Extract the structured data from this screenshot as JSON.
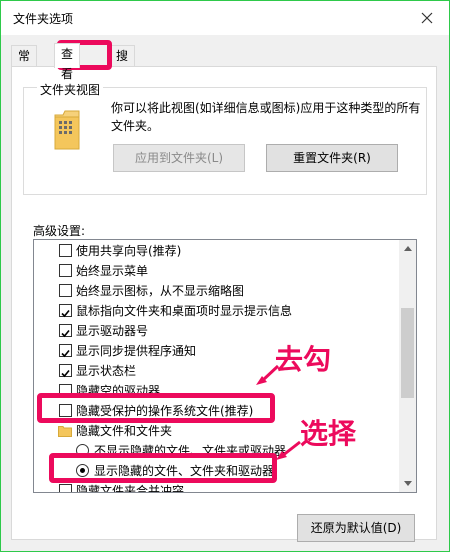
{
  "window": {
    "title": "文件夹选项"
  },
  "tabs": [
    {
      "label": "常规"
    },
    {
      "label": "查看"
    },
    {
      "label": "搜索"
    }
  ],
  "folder_views": {
    "title": "文件夹视图",
    "description": "你可以将此视图(如详细信息或图标)应用于这种类型的所有文件夹。",
    "apply_button": "应用到文件夹(L)",
    "reset_button": "重置文件夹(R)"
  },
  "advanced": {
    "label": "高级设置:",
    "items": [
      {
        "text": "使用共享向导(推荐)",
        "checked": false
      },
      {
        "text": "始终显示菜单",
        "checked": false
      },
      {
        "text": "始终显示图标，从不显示缩略图",
        "checked": false
      },
      {
        "text": "鼠标指向文件夹和桌面项时显示提示信息",
        "checked": true
      },
      {
        "text": "显示驱动器号",
        "checked": true
      },
      {
        "text": "显示同步提供程序通知",
        "checked": true
      },
      {
        "text": "显示状态栏",
        "checked": true
      },
      {
        "text": "隐藏空的驱动器",
        "checked": false
      },
      {
        "text": "隐藏受保护的操作系统文件(推荐)",
        "checked": false
      },
      {
        "text": "隐藏文件和文件夹"
      },
      {
        "text": "不显示隐藏的文件、文件夹或驱动器",
        "selected": false
      },
      {
        "text": "显示隐藏的文件、文件夹和驱动器",
        "selected": true
      },
      {
        "text": "隐藏文件夹合并冲突",
        "checked": false
      }
    ]
  },
  "restore_button": "还原为默认值(D)",
  "annotations": {
    "uncheck": "去勾",
    "select": "选择"
  },
  "colors": {
    "highlight": "#ec0a5c",
    "window_border": "#2ec94a"
  }
}
